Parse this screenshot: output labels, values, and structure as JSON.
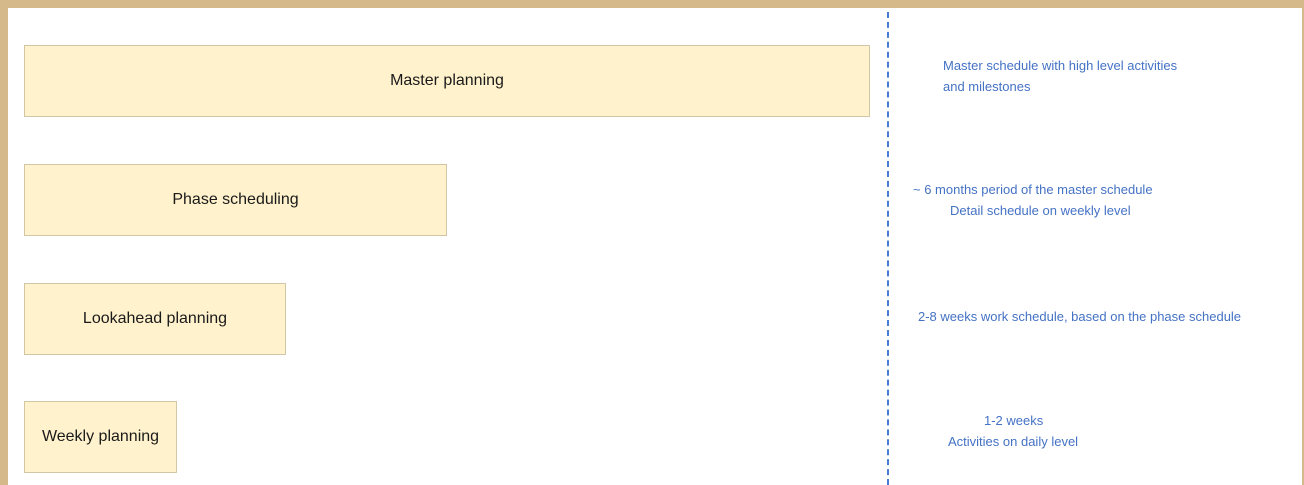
{
  "levels": [
    {
      "label": "Master planning",
      "note": [
        "Master schedule with high level activities",
        "and milestones"
      ]
    },
    {
      "label": "Phase scheduling",
      "note": [
        "~ 6 months period of the master schedule",
        "Detail schedule on weekly level"
      ]
    },
    {
      "label": "Lookahead planning",
      "note": [
        "2-8 weeks work schedule, based on the phase schedule"
      ]
    },
    {
      "label": "Weekly planning",
      "note": [
        "1-2 weeks",
        "Activities on daily level"
      ]
    }
  ],
  "colors": {
    "box_fill": "#fff2cc",
    "box_border": "#d2c7a4",
    "note_text": "#4472c4",
    "divider": "#4a7bd4",
    "frame": "#d6b98a"
  }
}
